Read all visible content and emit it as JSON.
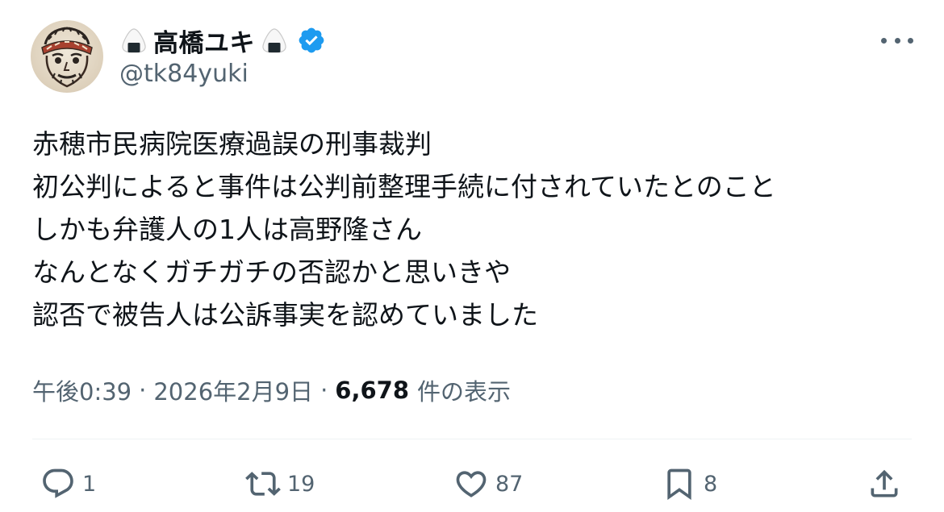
{
  "user": {
    "display_name": "高橋ユキ",
    "handle": "@tk84yuki",
    "verified": true,
    "name_emoji": "onigiri-icon"
  },
  "tweet": {
    "lines": [
      "赤穂市民病院医療過誤の刑事裁判",
      "初公判によると事件は公判前整理手続に付されていたとのこと",
      "しかも弁護人の1人は高野隆さん",
      "なんとなくガチガチの否認かと思いきや",
      "認否で被告人は公訴事実を認めていました"
    ]
  },
  "meta": {
    "time": "午後0:39",
    "separator": "·",
    "date": "2026年2月9日",
    "views_count": "6,678",
    "views_label": "件の表示"
  },
  "actions": {
    "replies": "1",
    "retweets": "19",
    "likes": "87",
    "bookmarks": "8"
  },
  "colors": {
    "text": "#0f1419",
    "secondary": "#536471",
    "verified": "#1d9bf0",
    "divider": "#eff3f4"
  }
}
